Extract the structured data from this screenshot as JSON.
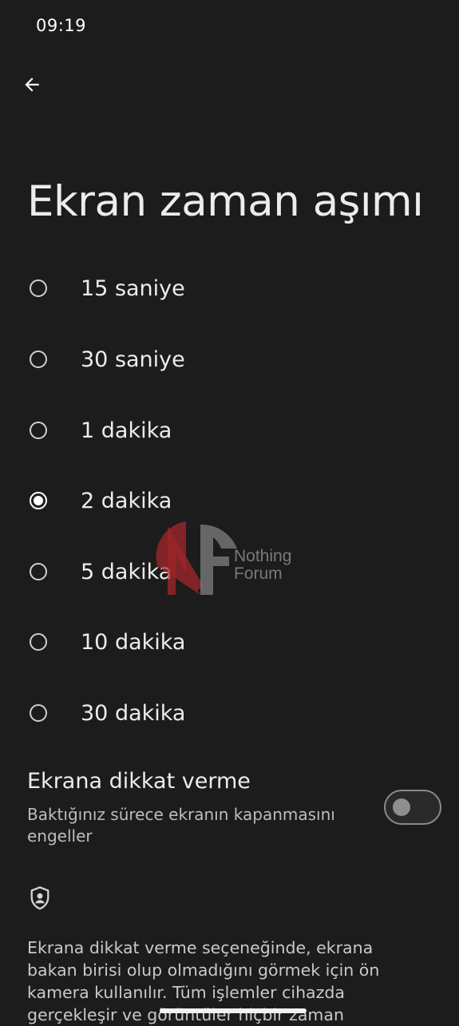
{
  "status_bar": {
    "time": "09:19"
  },
  "header": {
    "back_icon": "arrow-left-icon"
  },
  "page": {
    "title": "Ekran zaman aşımı"
  },
  "options": [
    {
      "label": "15 saniye",
      "selected": false
    },
    {
      "label": "30 saniye",
      "selected": false
    },
    {
      "label": "1 dakika",
      "selected": false
    },
    {
      "label": "2 dakika",
      "selected": true
    },
    {
      "label": "5 dakika",
      "selected": false
    },
    {
      "label": "10 dakika",
      "selected": false
    },
    {
      "label": "30 dakika",
      "selected": false
    }
  ],
  "screen_attention": {
    "title": "Ekrana dikkat verme",
    "description": "Baktığınız sürece ekranın kapanmasını engeller",
    "enabled": false
  },
  "privacy_info": {
    "icon": "shield-user-icon",
    "text": "Ekrana dikkat verme seçeneğinde, ekrana bakan birisi olup olmadığını görmek için ön kamera kullanılır. Tüm işlemler cihazda gerçekleşir ve görüntüler hiçbir zaman"
  },
  "watermark": {
    "line1": "Nothing",
    "line2": "Forum"
  },
  "colors": {
    "background": "#1c1c1c",
    "text": "#ececec",
    "watermark_red": "#b0282d",
    "watermark_gray": "#8a8a8a"
  }
}
